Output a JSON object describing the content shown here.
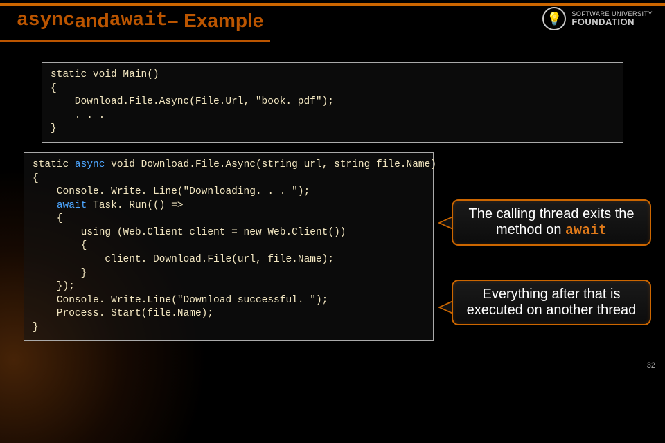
{
  "title": {
    "kw1": "async",
    "mid": " and ",
    "kw2": "await",
    "tail": " – Example"
  },
  "logo": {
    "line1": "SOFTWARE UNIVERSITY",
    "line2": "FOUNDATION"
  },
  "code1": "static void Main()\n{\n    Download.File.Async(File.Url, \"book. pdf\");\n    . . .\n}",
  "code2": {
    "l1a": "static ",
    "l1b": "async",
    "l1c": " void Download.File.Async(string url, string file.Name)",
    "l2": "{",
    "l3": "    Console. Write. Line(\"Downloading. . . \");",
    "l4a": "    ",
    "l4b": "await",
    "l4c": " Task. Run(() =>",
    "l5": "    {",
    "l6": "        using (Web.Client client = new Web.Client())",
    "l7": "        {",
    "l8": "            client. Download.File(url, file.Name);",
    "l9": "        }",
    "l10": "    });",
    "l11": "    Console. Write.Line(\"Download successful. \");",
    "l12": "    Process. Start(file.Name);",
    "l13": "}"
  },
  "callout1": {
    "pre": "The calling thread exits the method on ",
    "kw": "await"
  },
  "callout2": "Everything after that is executed on another thread",
  "pagenum": "32"
}
